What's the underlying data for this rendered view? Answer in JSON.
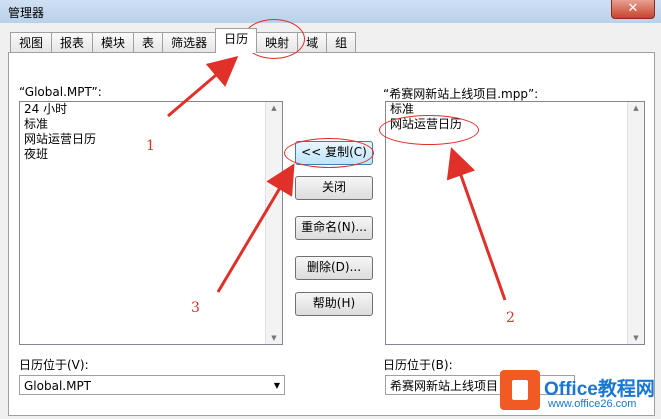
{
  "window": {
    "title": "管理器",
    "close_glyph": "✕"
  },
  "tabs": [
    {
      "label": "视图"
    },
    {
      "label": "报表"
    },
    {
      "label": "模块"
    },
    {
      "label": "表"
    },
    {
      "label": "筛选器"
    },
    {
      "label": "日历",
      "active": true
    },
    {
      "label": "映射"
    },
    {
      "label": "域"
    },
    {
      "label": "组"
    }
  ],
  "left": {
    "header": "“Global.MPT”:",
    "items": [
      "24 小时",
      "标准",
      "网站运营日历",
      "夜班"
    ],
    "location_label": "日历位于(V):",
    "location_value": "Global.MPT"
  },
  "right": {
    "header": "“希赛网新站上线项目.mpp”:",
    "items": [
      "标准",
      "网站运营日历"
    ],
    "location_label": "日历位于(B):",
    "location_value": "希赛网新站上线项目"
  },
  "buttons": {
    "copy": "<< 复制(C)",
    "close": "关闭",
    "rename": "重命名(N)...",
    "delete": "删除(D)...",
    "help": "帮助(H)"
  },
  "annotations": {
    "a1": "1",
    "a2": "2",
    "a3": "3"
  },
  "watermark": {
    "line1": "Office教程网",
    "line2": "www.office26.com"
  },
  "colors": {
    "annotation": "#e0302a",
    "watermark": "#1976d2",
    "logo": "#f15a22"
  }
}
